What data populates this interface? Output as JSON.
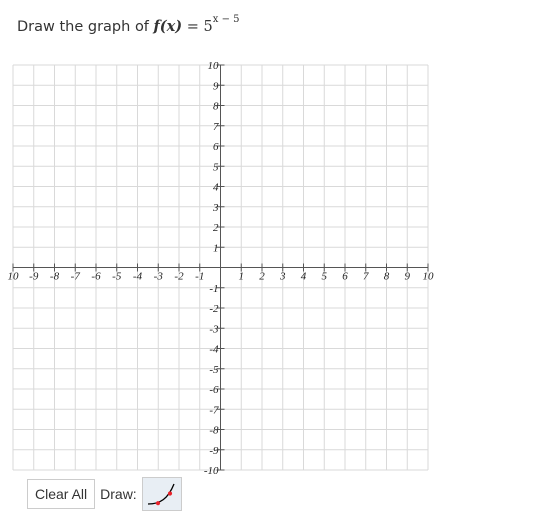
{
  "question": {
    "prefix": "Draw the graph of",
    "function_name": "f(x)",
    "equals": "=",
    "base": "5",
    "exponent": "x − 5"
  },
  "graph": {
    "x_range": [
      -10,
      10
    ],
    "y_range": [
      -10,
      10
    ],
    "grid": true,
    "x_tick_labels": [
      "10",
      "-9",
      "-8",
      "-7",
      "-6",
      "-5",
      "-4",
      "-3",
      "-2",
      "-1",
      "1",
      "2",
      "3",
      "4",
      "5",
      "6",
      "7",
      "8",
      "9",
      "10"
    ],
    "y_tick_labels": [
      "10",
      "9",
      "8",
      "7",
      "6",
      "5",
      "4",
      "3",
      "2",
      "1",
      "-1",
      "-2",
      "-3",
      "-4",
      "-5",
      "-6",
      "-7",
      "-8",
      "-9",
      "-10"
    ],
    "colors": {
      "grid": "#d9d9d9",
      "axis": "#555555",
      "tool_curve": "#000000",
      "tool_points": "#e8222a"
    }
  },
  "toolbar": {
    "clear_label": "Clear All",
    "draw_label": "Draw:",
    "tool_icon": "exponential-curve-icon"
  }
}
